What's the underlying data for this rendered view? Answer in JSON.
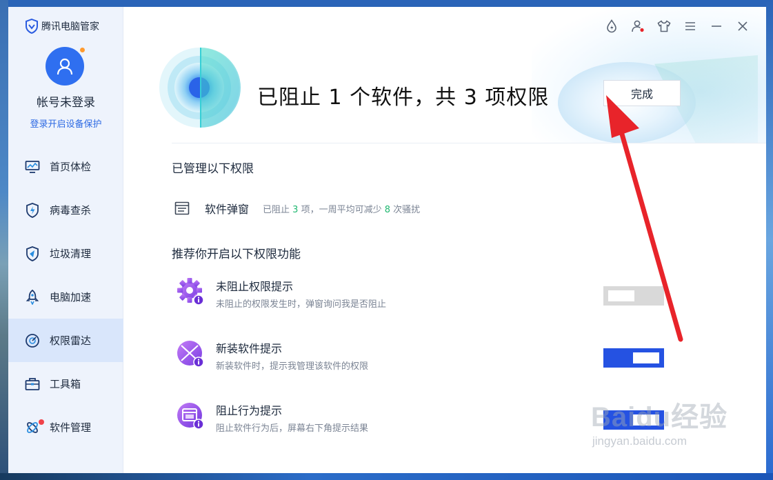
{
  "app": {
    "name": "腾讯电脑管家"
  },
  "account": {
    "name": "帐号未登录",
    "login_link": "登录开启设备保护"
  },
  "nav": [
    {
      "label": "首页体检",
      "icon": "monitor-icon"
    },
    {
      "label": "病毒查杀",
      "icon": "shield-bolt-icon"
    },
    {
      "label": "垃圾清理",
      "icon": "cleanup-icon"
    },
    {
      "label": "电脑加速",
      "icon": "rocket-icon"
    },
    {
      "label": "权限雷达",
      "icon": "radar-icon",
      "active": true
    },
    {
      "label": "工具箱",
      "icon": "toolbox-icon"
    },
    {
      "label": "软件管理",
      "icon": "apps-icon",
      "badge": true
    }
  ],
  "titlebar": {
    "icons": [
      "boost-icon",
      "user-notify-icon",
      "skin-icon",
      "menu-icon",
      "minimize-icon",
      "close-icon"
    ]
  },
  "result": {
    "headline": "已阻止 1 个软件，共 3 项权限",
    "done_button": "完成"
  },
  "managed": {
    "title": "已管理以下权限",
    "item": {
      "label": "软件弹窗",
      "desc_prefix": "已阻止",
      "blocked_count": "3",
      "desc_middle": "项，一周平均可减少",
      "reduced_count": "8",
      "desc_suffix": "次骚扰"
    }
  },
  "recommend": {
    "title": "推荐你开启以下权限功能",
    "features": [
      {
        "title": "未阻止权限提示",
        "desc": "未阻止的权限发生时，弹窗询问我是否阻止",
        "enabled": false,
        "icon": "gear-info-icon"
      },
      {
        "title": "新装软件提示",
        "desc": "新装软件时，提示我管理该软件的权限",
        "enabled": true,
        "icon": "flower-info-icon"
      },
      {
        "title": "阻止行为提示",
        "desc": "阻止软件行为后，屏幕右下角提示结果",
        "enabled": true,
        "icon": "window-info-icon"
      }
    ]
  },
  "watermark": {
    "logo": "Baidu经验",
    "url": "jingyan.baidu.com"
  },
  "colors": {
    "accent": "#2552e2",
    "link": "#2d6ae3",
    "count_green": "#1fb870",
    "active_nav": "#d9e6fb",
    "arrow": "#e8242a"
  }
}
